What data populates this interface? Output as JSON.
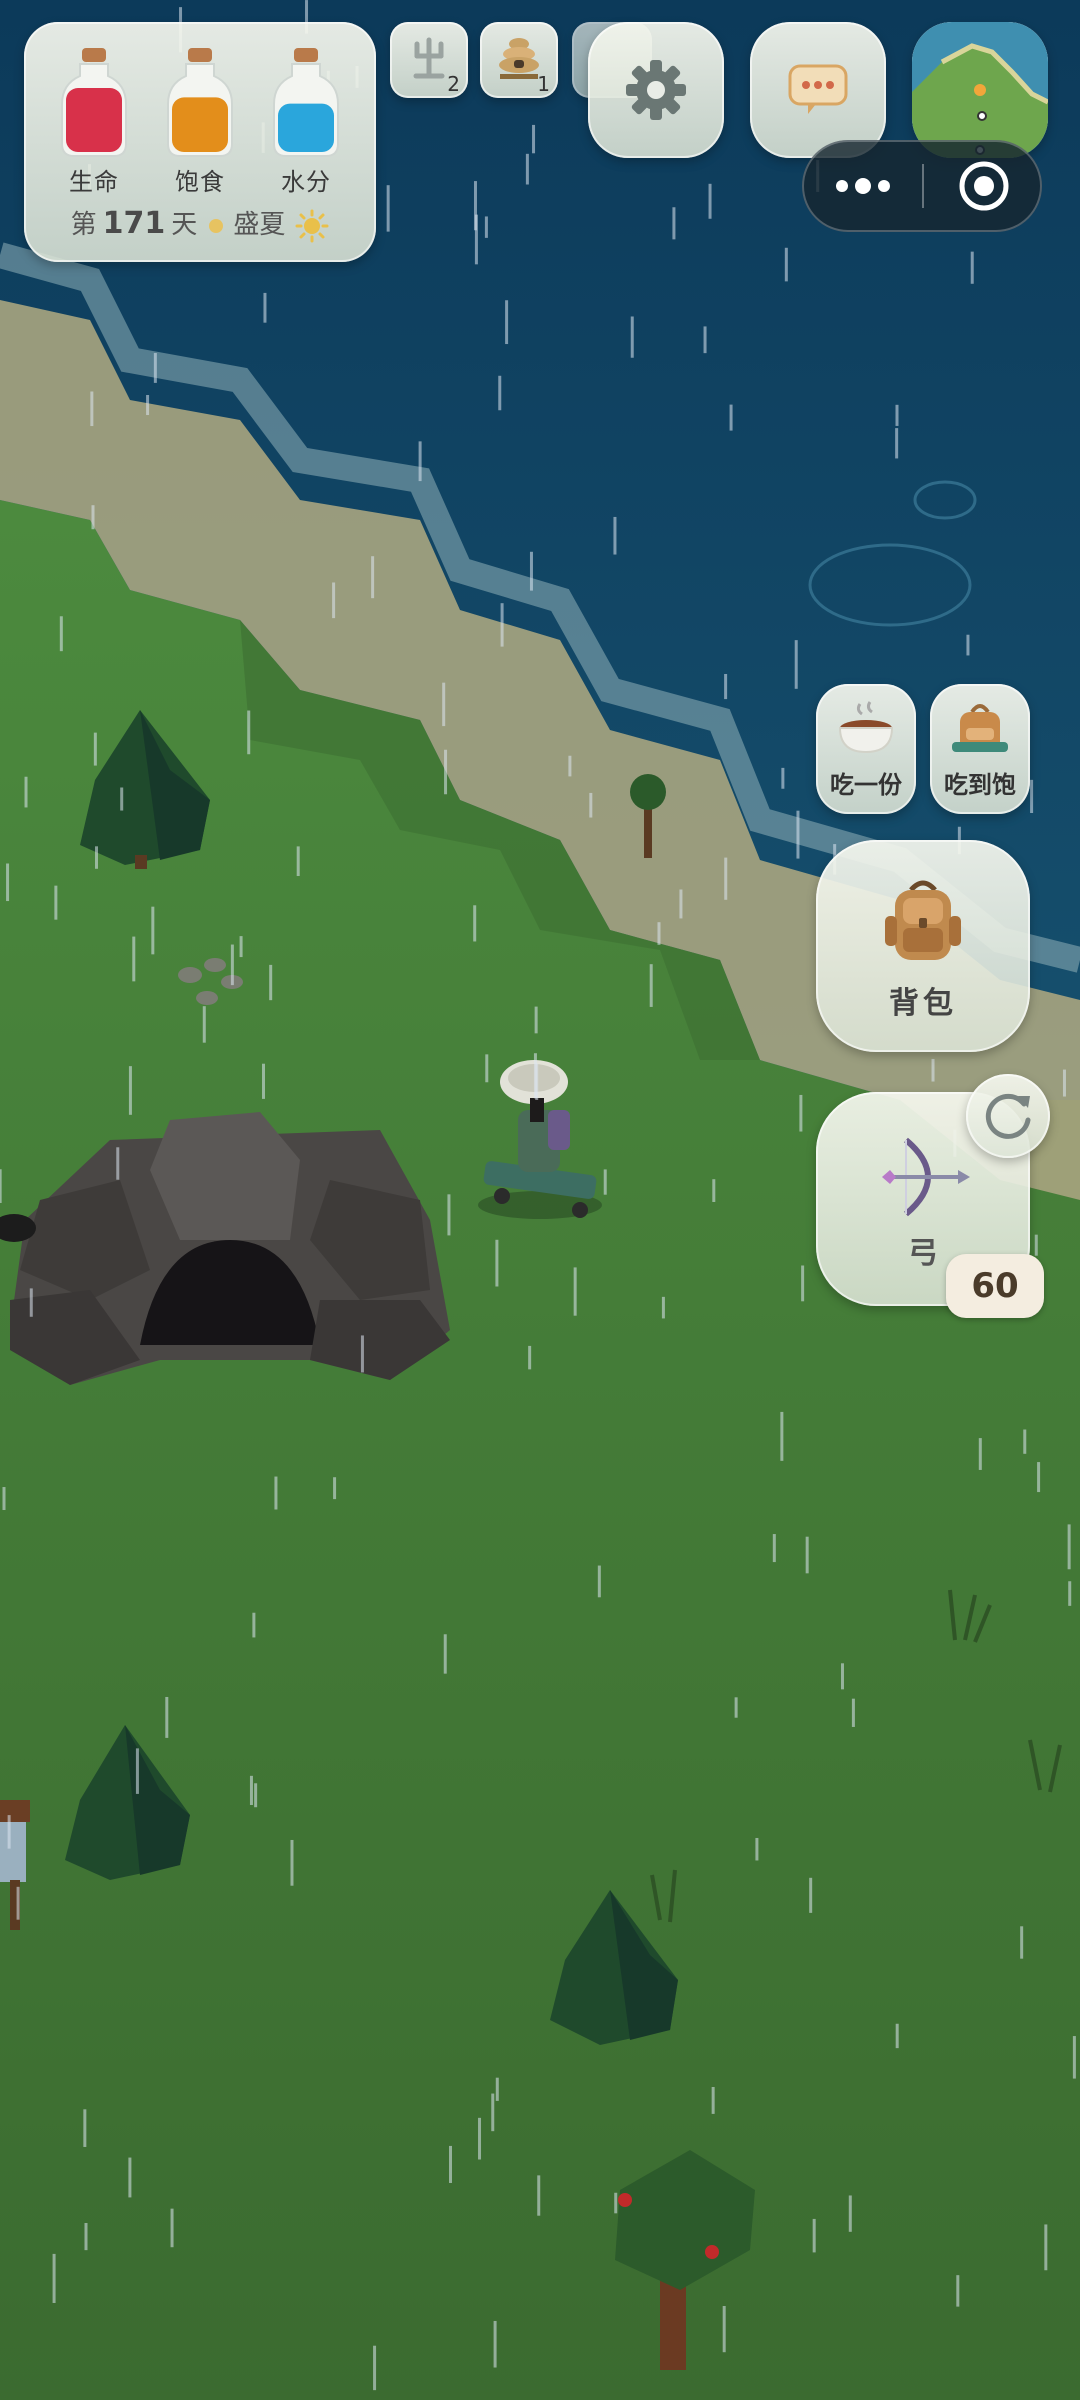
{
  "stats": {
    "health_label": "生命",
    "hunger_label": "饱食",
    "water_label": "水分",
    "day_prefix": "第",
    "day_number": "171",
    "day_suffix": "天",
    "season": "盛夏",
    "health_color": "#d8314a",
    "hunger_color": "#e38e1b",
    "water_color": "#2aa6dc",
    "health_level": 0.82,
    "hunger_level": 0.7,
    "water_level": 0.62
  },
  "top_bar": {
    "quick_slot_1_count": "2",
    "quick_slot_1_icon": "totem-icon",
    "quick_slot_2_count": "1",
    "quick_slot_2_icon": "beehive-icon",
    "settings_icon": "gear-icon",
    "chat_icon": "chat-bubble-icon",
    "map_icon": "minimap"
  },
  "system_capsule": {
    "more_icon": "more-dots-icon",
    "close_icon": "record-circle-icon"
  },
  "food": {
    "eat_one_label": "吃一份",
    "eat_full_label": "吃到饱"
  },
  "backpack": {
    "label": "背包"
  },
  "weapon": {
    "name": "弓",
    "ammo": "60",
    "reload_icon": "refresh-icon"
  }
}
